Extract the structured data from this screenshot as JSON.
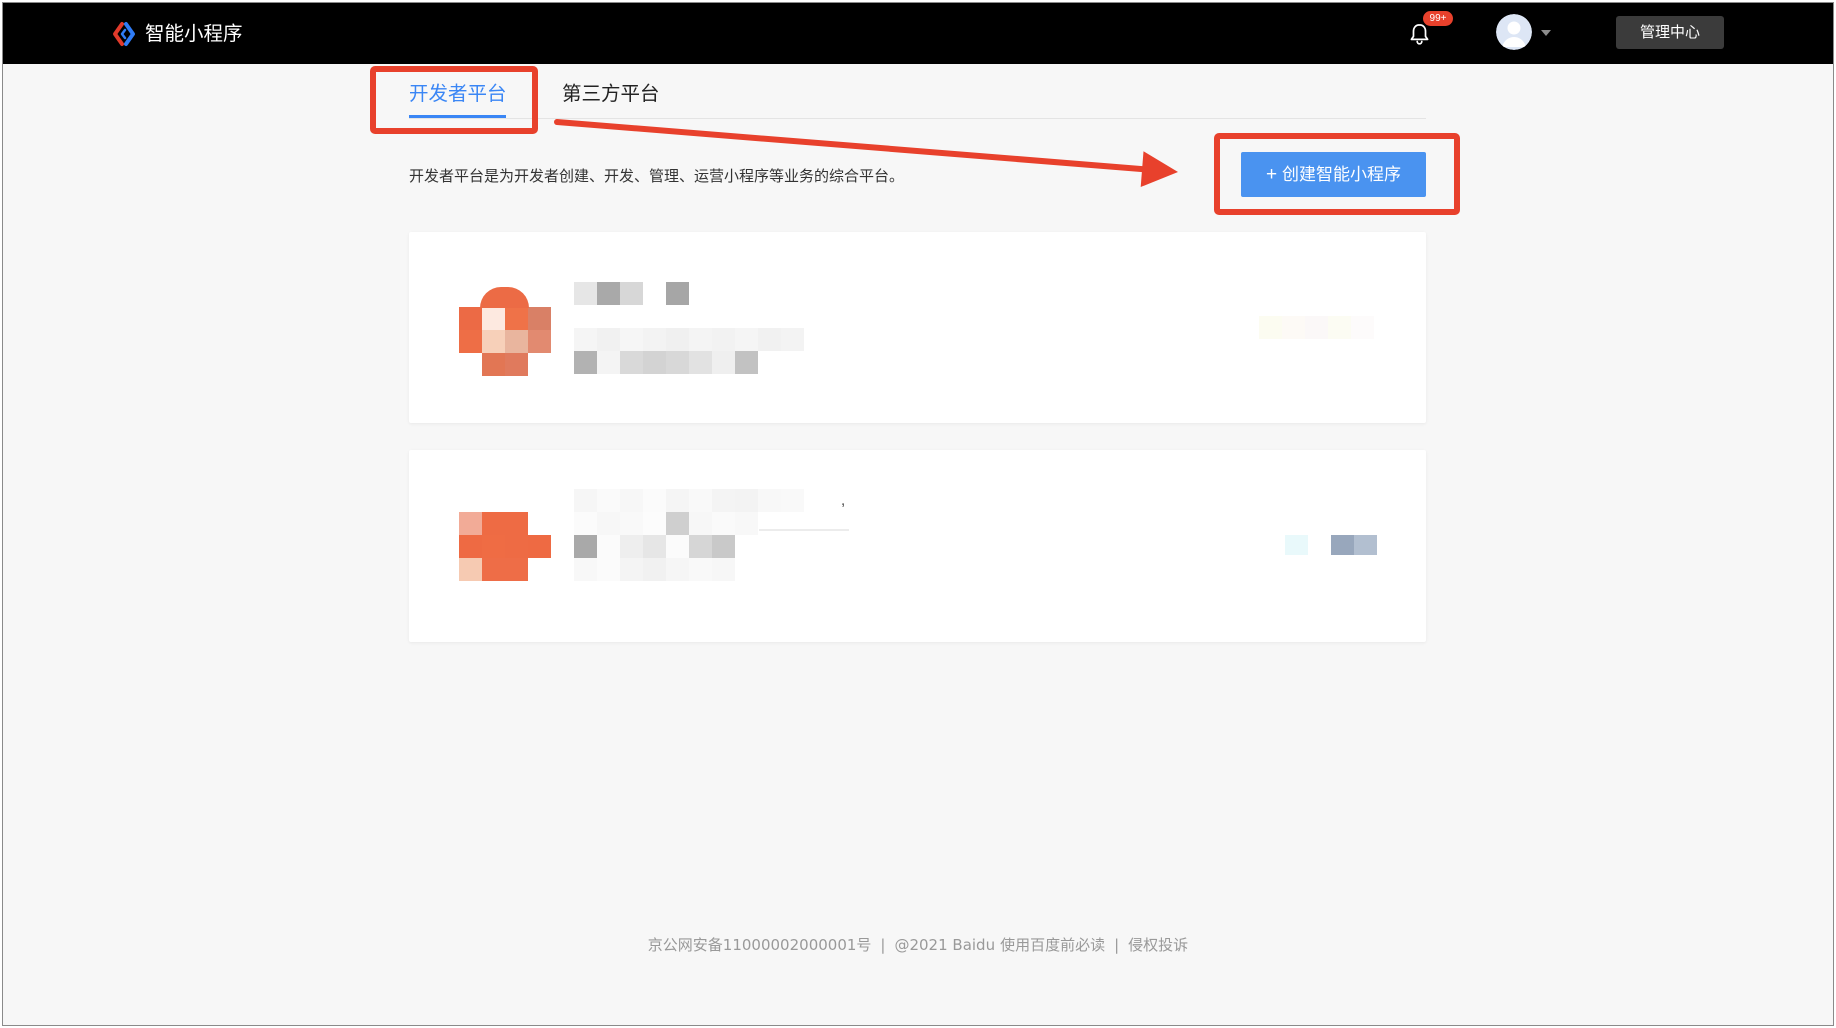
{
  "colors": {
    "header_bg": "#000000",
    "accent": "#3a86f5",
    "button": "#4a93f0",
    "annotation": "#e8412c",
    "badge": "#e8412c",
    "admin_button": "#3b3b3b",
    "page_bg": "#f7f7f7"
  },
  "header": {
    "logo_icon": "smart-program-logo-icon",
    "title": "智能小程序",
    "notification": {
      "icon": "bell-icon",
      "badge": "99+"
    },
    "avatar": {
      "icon": "avatar-icon",
      "dropdown_icon": "caret-down-icon"
    },
    "admin_button": "管理中心"
  },
  "tabs": {
    "items": [
      {
        "label": "开发者平台",
        "active": true
      },
      {
        "label": "第三方平台",
        "active": false
      }
    ]
  },
  "intro": {
    "description": "开发者平台是为开发者创建、开发、管理、运营小程序等业务的综合平台。"
  },
  "create_button": {
    "icon_glyph": "+",
    "label": "创建智能小程序"
  },
  "app_cards": [
    {
      "text_fragment": ""
    },
    {
      "text_fragment": ","
    }
  ],
  "footer": {
    "icp": "京公网安备11000002000001号",
    "separator": "|",
    "copyright": "@2021 Baidu",
    "terms_link": "使用百度前必读",
    "complaint_link": "侵权投诉"
  }
}
